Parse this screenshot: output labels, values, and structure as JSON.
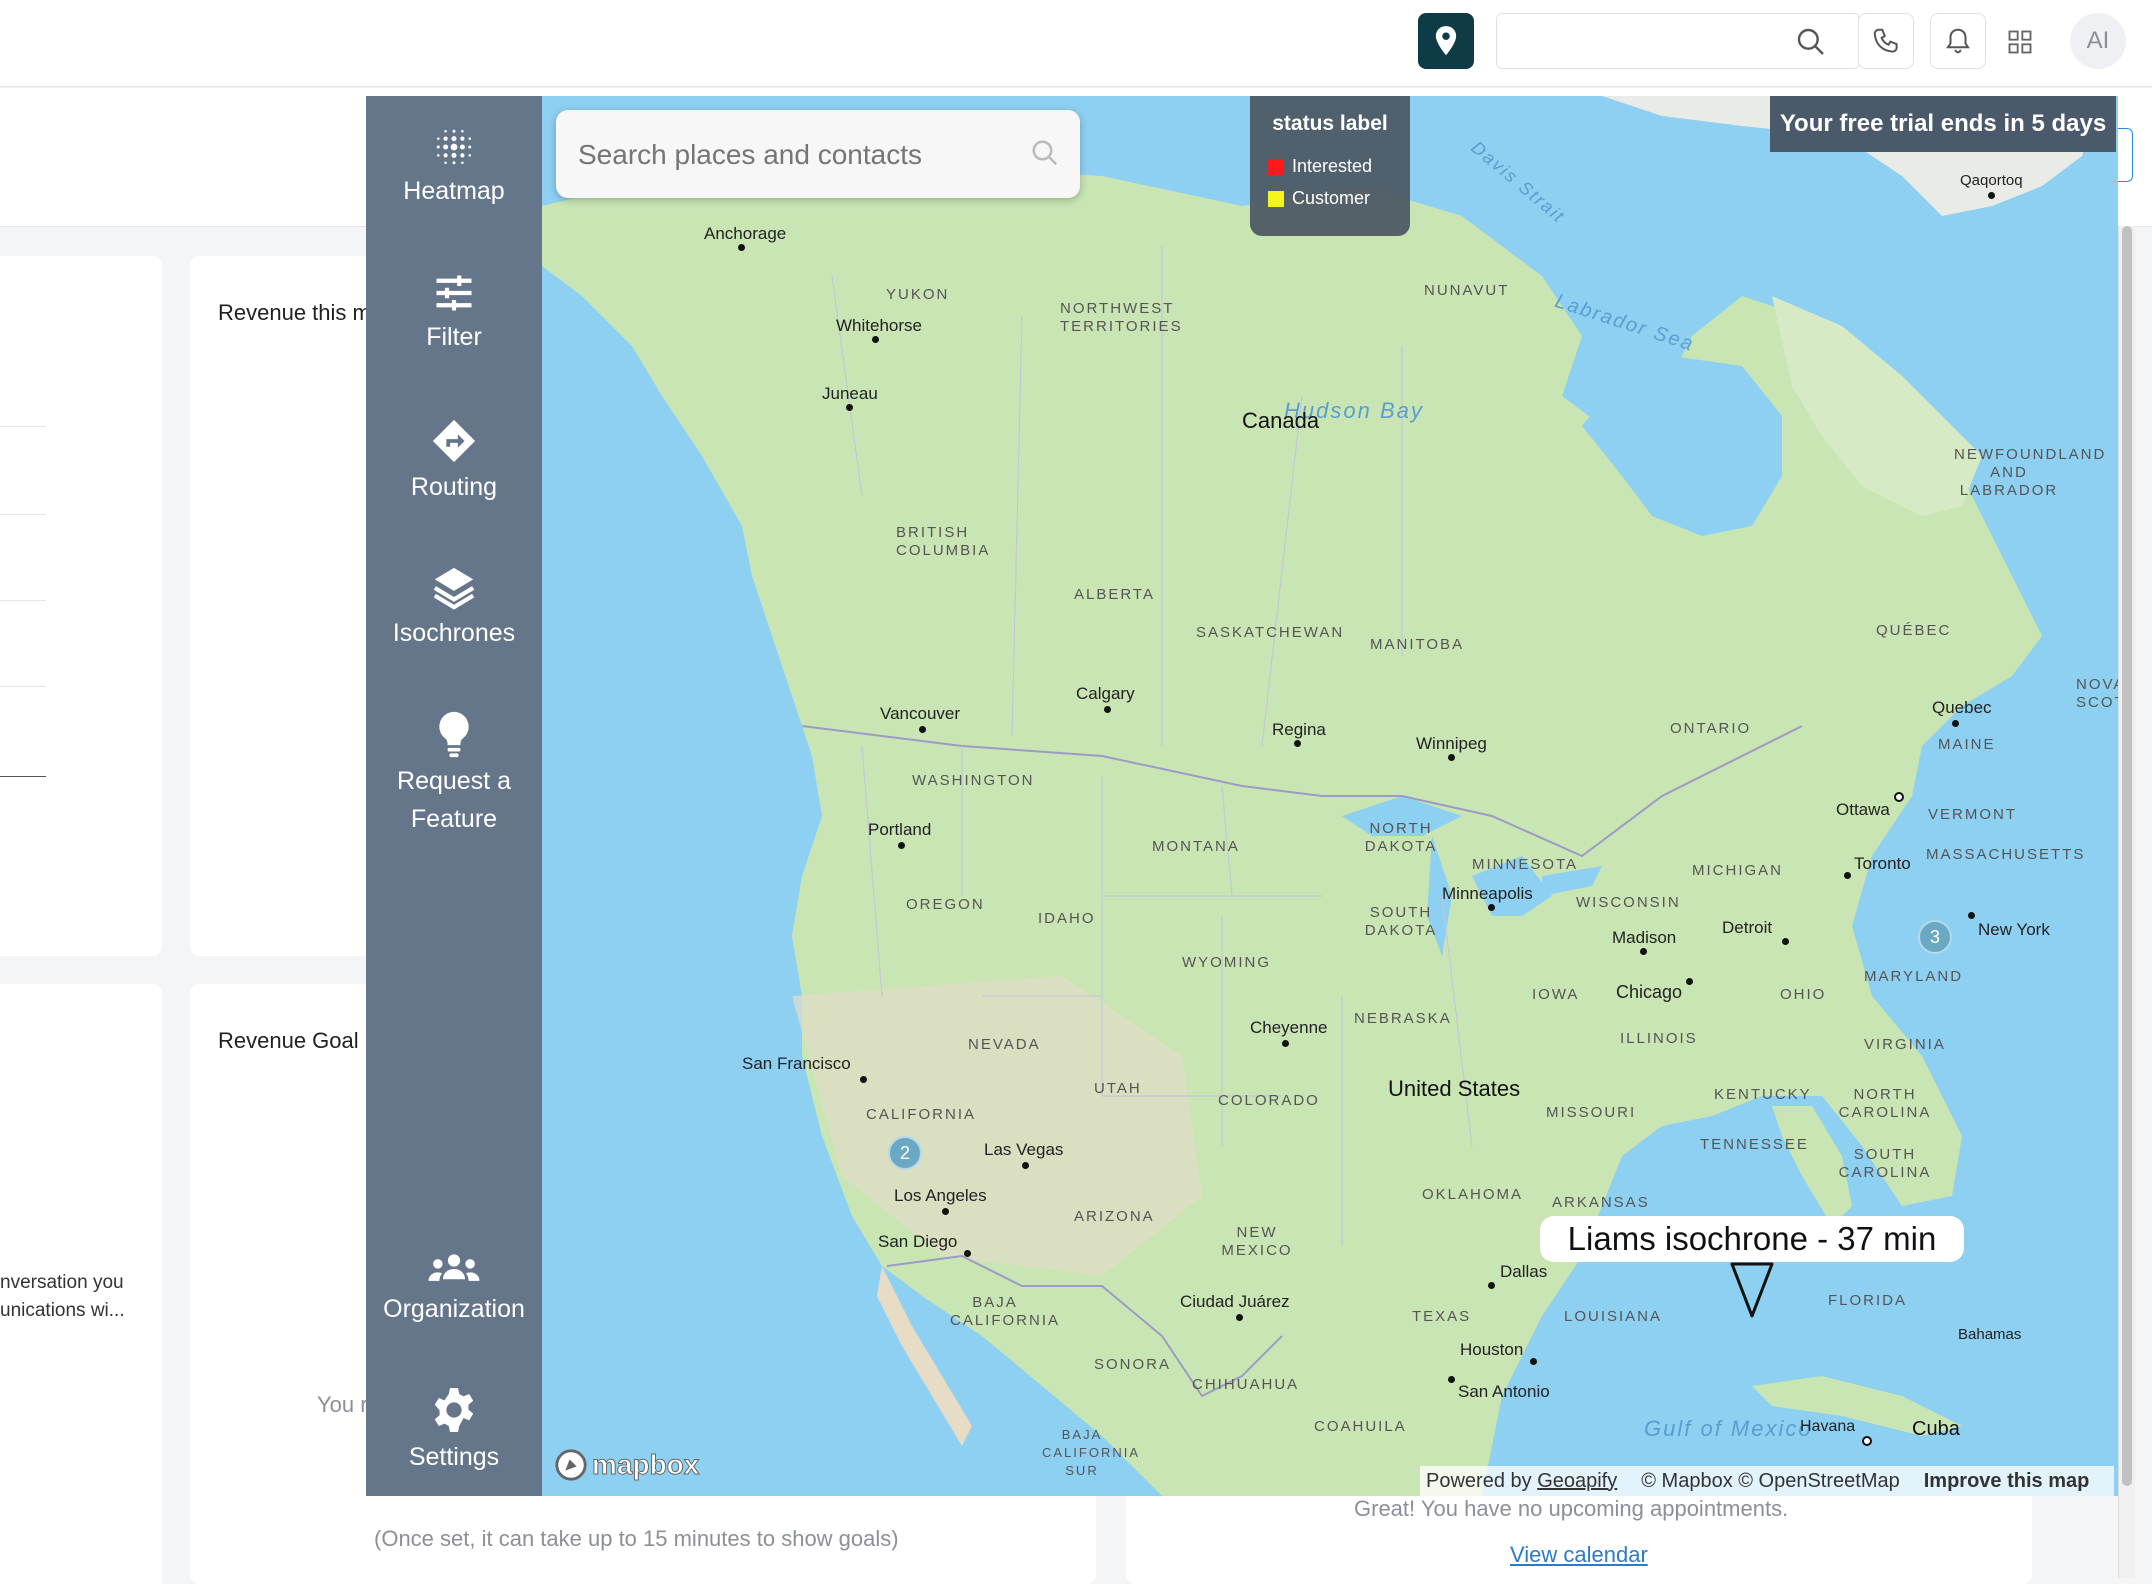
{
  "topbar": {
    "search_value": "",
    "avatar_initials": "AI",
    "icons": [
      "map-pin-icon",
      "search-icon",
      "phone-icon",
      "bell-icon",
      "apps-grid-icon"
    ]
  },
  "background": {
    "card1_title": "Revenue this m",
    "card2_title": "Revenue Goal",
    "left_text_1": "nversation you",
    "left_text_2": "unications wi...",
    "partial_text": "You r",
    "goal_note": "(Once set, it can take up to 15 minutes to show goals)",
    "appointments_text": "Great! You have no upcoming appointments.",
    "view_calendar": "View calendar"
  },
  "sidebar": {
    "items": [
      {
        "label": "Heatmap",
        "icon": "heatmap-icon"
      },
      {
        "label": "Filter",
        "icon": "sliders-icon"
      },
      {
        "label": "Routing",
        "icon": "route-sign-icon"
      },
      {
        "label": "Isochrones",
        "icon": "layers-icon"
      },
      {
        "label": "Request a Feature",
        "icon": "lightbulb-icon"
      },
      {
        "label": "Organization",
        "icon": "people-icon"
      },
      {
        "label": "Settings",
        "icon": "gear-icon"
      }
    ]
  },
  "map": {
    "search_placeholder": "Search places and contacts",
    "legend": {
      "title": "status label",
      "entries": [
        {
          "label": "Interested",
          "color": "#ff1a1a"
        },
        {
          "label": "Customer",
          "color": "#f5f51a"
        }
      ]
    },
    "trial_banner": "Your free trial ends in 5 days",
    "isochrone_label": "Liams isochrone - 37 min",
    "clusters": [
      "2",
      "3"
    ],
    "logo": "mapbox",
    "attribution": {
      "powered": "Powered by",
      "geoapify": "Geoapify",
      "copyright": "© Mapbox © OpenStreetMap",
      "improve": "Improve this map"
    },
    "countries": [
      "Canada",
      "United States",
      "Cuba"
    ],
    "cities": [
      "Anchorage",
      "Whitehorse",
      "Juneau",
      "Vancouver",
      "Calgary",
      "Regina",
      "Winnipeg",
      "Portland",
      "San Francisco",
      "Las Vegas",
      "Los Angeles",
      "San Diego",
      "Ciudad Juárez",
      "Cheyenne",
      "Minneapolis",
      "Madison",
      "Chicago",
      "Detroit",
      "Toronto",
      "Ottawa",
      "Quebec",
      "New York",
      "Dallas",
      "Houston",
      "San Antonio",
      "Havana",
      "Qaqortoq",
      "Bahamas"
    ],
    "regions": [
      "YUKON",
      "NORTHWEST TERRITORIES",
      "NUNAVUT",
      "BRITISH COLUMBIA",
      "ALBERTA",
      "SASKATCHEWAN",
      "MANITOBA",
      "ONTARIO",
      "QUÉBEC",
      "WASHINGTON",
      "OREGON",
      "IDAHO",
      "MONTANA",
      "WYOMING",
      "NORTH DAKOTA",
      "SOUTH DAKOTA",
      "NEBRASKA",
      "MINNESOTA",
      "WISCONSIN",
      "MICHIGAN",
      "IOWA",
      "ILLINOIS",
      "OHIO",
      "NEVADA",
      "UTAH",
      "COLORADO",
      "CALIFORNIA",
      "ARIZONA",
      "NEW MEXICO",
      "OKLAHOMA",
      "TEXAS",
      "MISSOURI",
      "KENTUCKY",
      "TENNESSEE",
      "ARKANSAS",
      "LOUISIANA",
      "NORTH CAROLINA",
      "SOUTH CAROLINA",
      "VIRGINIA",
      "MARYLAND",
      "FLORIDA",
      "MAINE",
      "VERMONT",
      "MASSACHUSETTS",
      "BAJA CALIFORNIA",
      "SONORA",
      "CHIHUAHUA",
      "COAHUILA",
      "NEWFOUNDLAND AND LABRADOR",
      "NOVA SCOTIA",
      "BAJA CALIFORNIA SUR"
    ],
    "water": [
      "Hudson Bay",
      "Labrador Sea",
      "Davis Strait",
      "Gulf of Mexico"
    ]
  }
}
